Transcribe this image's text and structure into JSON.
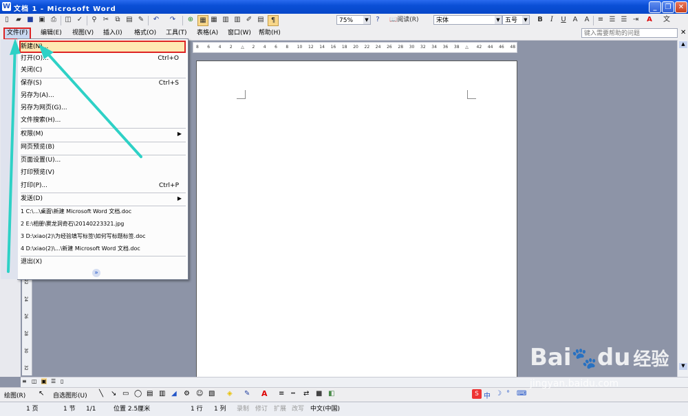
{
  "window": {
    "title": "文档 1 - Microsoft Word",
    "app_icon": "W"
  },
  "toolbar": {
    "zoom": "75%",
    "read_button": "阅读(R)",
    "font_name": "宋体",
    "font_size": "五号",
    "bold": "B",
    "italic": "I",
    "underline": "U"
  },
  "menubar": {
    "items": [
      "文件(F)",
      "编辑(E)",
      "视图(V)",
      "插入(I)",
      "格式(O)",
      "工具(T)",
      "表格(A)",
      "窗口(W)",
      "帮助(H)"
    ],
    "help_placeholder": "键入需要帮助的问题"
  },
  "ruler": {
    "left_ticks": [
      "8",
      "6",
      "4",
      "2"
    ],
    "ticks": [
      "2",
      "4",
      "6",
      "8",
      "10",
      "12",
      "14",
      "16",
      "18",
      "20",
      "22",
      "24",
      "26",
      "28",
      "30",
      "32",
      "34",
      "36",
      "38"
    ],
    "right_ticks": [
      "42",
      "44",
      "46",
      "48"
    ]
  },
  "vruler_ticks": [
    "22",
    "24",
    "26",
    "28",
    "30",
    "32"
  ],
  "file_menu": {
    "items": [
      {
        "label": "新建(N)...",
        "shortcut": ""
      },
      {
        "label": "打开(O)...",
        "shortcut": "Ctrl+O"
      },
      {
        "label": "关闭(C)",
        "shortcut": ""
      },
      {
        "label": "保存(S)",
        "shortcut": "Ctrl+S"
      },
      {
        "label": "另存为(A)...",
        "shortcut": ""
      },
      {
        "label": "另存为网页(G)...",
        "shortcut": ""
      },
      {
        "label": "文件搜索(H)...",
        "shortcut": ""
      },
      {
        "label": "权限(M)",
        "shortcut": ""
      },
      {
        "label": "网页预览(B)",
        "shortcut": ""
      },
      {
        "label": "页面设置(U)...",
        "shortcut": ""
      },
      {
        "label": "打印预览(V)",
        "shortcut": ""
      },
      {
        "label": "打印(P)...",
        "shortcut": "Ctrl+P"
      },
      {
        "label": "发送(D)",
        "shortcut": ""
      },
      {
        "label": "1 C:\\...\\桌面\\新建 Microsoft Word 文档.doc",
        "shortcut": ""
      },
      {
        "label": "2 E:\\相册\\窦龙洞奇石\\20140223321.jpg",
        "shortcut": ""
      },
      {
        "label": "3 D:\\xiao(2)\\为经验填写标签\\如何写标题标签.doc",
        "shortcut": ""
      },
      {
        "label": "4 D:\\xiao(2)\\...\\新建 Microsoft Word 文档.doc",
        "shortcut": ""
      },
      {
        "label": "退出(X)",
        "shortcut": ""
      }
    ],
    "expand_glyph": "»"
  },
  "drawbar": {
    "draw_label": "绘图(R)",
    "autoshape_label": "自选图形(U)",
    "ime_label": "中"
  },
  "status": {
    "page": "1 页",
    "section": "1 节",
    "page_of": "1/1",
    "position": "位置 2.5厘米",
    "line": "1 行",
    "col": "1 列",
    "rec": "录制",
    "trk": "修订",
    "ext": "扩展",
    "ovr": "改写",
    "lang": "中文(中国)"
  },
  "watermark": {
    "brand_a": "Bai",
    "brand_b": "du",
    "brand_c": "经验",
    "url": "jingyan.baidu.com"
  },
  "colors": {
    "title_bar": "#0a4fd6",
    "highlight_border": "#dd2222",
    "arrow": "#2ed1c6",
    "menu_hover": "#ffe8b3"
  }
}
